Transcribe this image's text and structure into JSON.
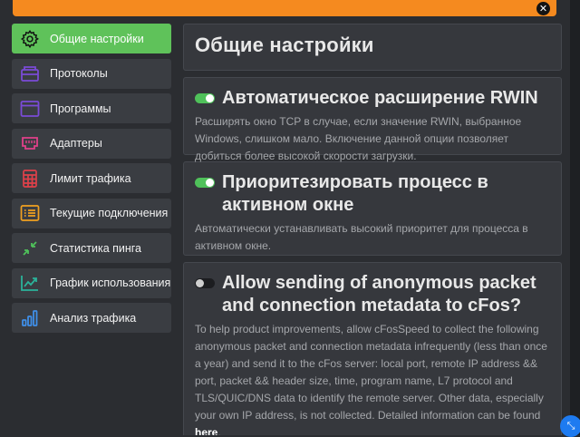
{
  "window": {
    "close_glyph": "✕"
  },
  "sidebar": {
    "items": [
      {
        "label": "Общие настройки",
        "icon": "gear-icon",
        "active": true
      },
      {
        "label": "Протоколы",
        "icon": "protocols-icon"
      },
      {
        "label": "Программы",
        "icon": "programs-icon"
      },
      {
        "label": "Адаптеры",
        "icon": "adapter-icon"
      },
      {
        "label": "Лимит трафика",
        "icon": "calculator-icon"
      },
      {
        "label": "Текущие подключения",
        "icon": "connections-list-icon"
      },
      {
        "label": "Статистика пинга",
        "icon": "ping-arrows-icon"
      },
      {
        "label": "График использования",
        "icon": "usage-chart-icon"
      },
      {
        "label": "Анализ трафика",
        "icon": "bar-chart-icon"
      }
    ]
  },
  "main": {
    "title": "Общие настройки",
    "settings": [
      {
        "enabled": true,
        "title": "Автоматическое расширение RWIN",
        "description": "Расширять окно TCP в случае, если значение RWIN, выбранное Windows, слишком мало. Включение данной опции позволяет добиться более высокой скорости загрузки."
      },
      {
        "enabled": true,
        "title": "Приоритезировать процесс в активном окне",
        "description": "Автоматически устанавливать высокий приоритет для процесса в активном окне."
      },
      {
        "enabled": false,
        "title": "Allow sending of anonymous packet and connection metadata to cFos?",
        "description": "To help product improvements, allow cFosSpeed to collect the following anonymous packet and connection metadata infrequently (less than once a year) and send it to the cFos server: local port, remote IP address && port, packet && header size, time, program name, L7 protocol and TLS/QUIC/DNS data to identify the remote server. Other data, especially your own IP address, is not collected. Detailed information can be found",
        "link": "here",
        "after_link": "."
      }
    ]
  },
  "colors": {
    "accent_orange": "#f58a1f",
    "active_green": "#5fc25a",
    "toggle_on": "#4fc15a",
    "background": "#2b2d31",
    "panel": "#36383d"
  },
  "corner_button_glyph": "⤡"
}
